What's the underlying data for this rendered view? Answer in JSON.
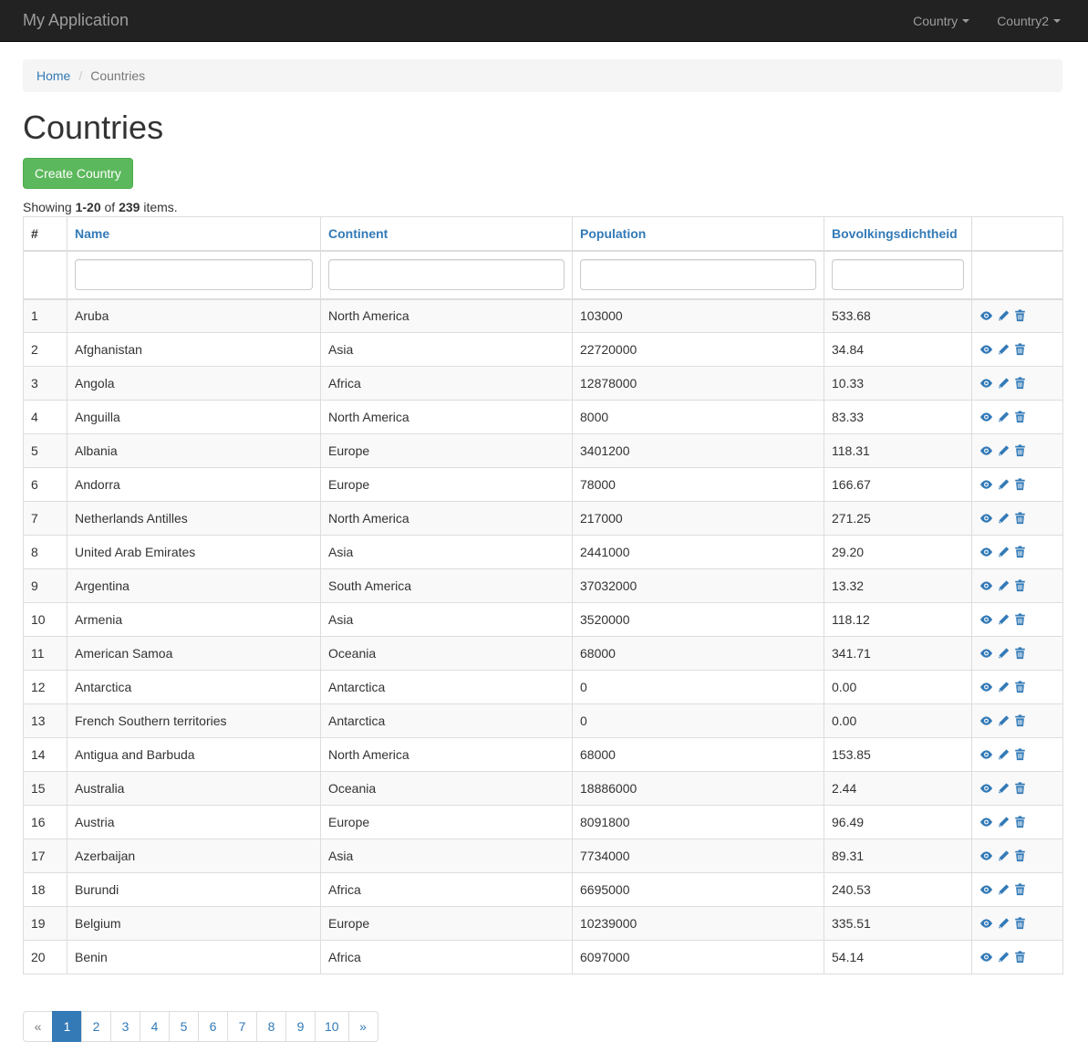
{
  "app": {
    "brand": "My Application"
  },
  "nav": {
    "items": [
      {
        "label": "Country"
      },
      {
        "label": "Country2"
      }
    ]
  },
  "breadcrumb": {
    "home": "Home",
    "current": "Countries"
  },
  "page": {
    "title": "Countries",
    "create_button": "Create Country"
  },
  "summary": {
    "prefix": "Showing ",
    "range": "1-20",
    "mid": " of ",
    "total": "239",
    "suffix": " items."
  },
  "table": {
    "headers": [
      "#",
      "Name",
      "Continent",
      "Population",
      "Bovolkingsdichtheid"
    ],
    "rows": [
      [
        "1",
        "Aruba",
        "North America",
        "103000",
        "533.68"
      ],
      [
        "2",
        "Afghanistan",
        "Asia",
        "22720000",
        "34.84"
      ],
      [
        "3",
        "Angola",
        "Africa",
        "12878000",
        "10.33"
      ],
      [
        "4",
        "Anguilla",
        "North America",
        "8000",
        "83.33"
      ],
      [
        "5",
        "Albania",
        "Europe",
        "3401200",
        "118.31"
      ],
      [
        "6",
        "Andorra",
        "Europe",
        "78000",
        "166.67"
      ],
      [
        "7",
        "Netherlands Antilles",
        "North America",
        "217000",
        "271.25"
      ],
      [
        "8",
        "United Arab Emirates",
        "Asia",
        "2441000",
        "29.20"
      ],
      [
        "9",
        "Argentina",
        "South America",
        "37032000",
        "13.32"
      ],
      [
        "10",
        "Armenia",
        "Asia",
        "3520000",
        "118.12"
      ],
      [
        "11",
        "American Samoa",
        "Oceania",
        "68000",
        "341.71"
      ],
      [
        "12",
        "Antarctica",
        "Antarctica",
        "0",
        "0.00"
      ],
      [
        "13",
        "French Southern territories",
        "Antarctica",
        "0",
        "0.00"
      ],
      [
        "14",
        "Antigua and Barbuda",
        "North America",
        "68000",
        "153.85"
      ],
      [
        "15",
        "Australia",
        "Oceania",
        "18886000",
        "2.44"
      ],
      [
        "16",
        "Austria",
        "Europe",
        "8091800",
        "96.49"
      ],
      [
        "17",
        "Azerbaijan",
        "Asia",
        "7734000",
        "89.31"
      ],
      [
        "18",
        "Burundi",
        "Africa",
        "6695000",
        "240.53"
      ],
      [
        "19",
        "Belgium",
        "Europe",
        "10239000",
        "335.51"
      ],
      [
        "20",
        "Benin",
        "Africa",
        "6097000",
        "54.14"
      ]
    ],
    "row_action_icons": [
      "eye-icon",
      "pencil-icon",
      "trash-icon"
    ]
  },
  "pagination": {
    "prev": "«",
    "pages": [
      "1",
      "2",
      "3",
      "4",
      "5",
      "6",
      "7",
      "8",
      "9",
      "10"
    ],
    "next": "»",
    "active": "1"
  },
  "colors": {
    "navbar": "#222222",
    "link": "#337ab7",
    "success": "#5cb85c"
  }
}
